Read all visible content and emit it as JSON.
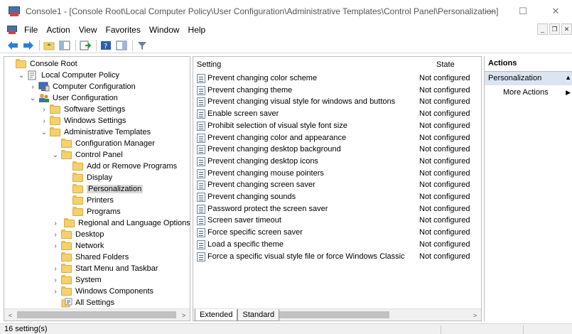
{
  "window": {
    "title": "Console1 - [Console Root\\Local Computer Policy\\User Configuration\\Administrative Templates\\Control Panel\\Personalization]",
    "minimize": "—",
    "maximize": "☐",
    "close": "✕"
  },
  "menu": {
    "items": [
      "File",
      "Action",
      "View",
      "Favorites",
      "Window",
      "Help"
    ],
    "mdi_minimize": "_",
    "mdi_restore": "❐",
    "mdi_close": "✕"
  },
  "tree": {
    "items": [
      {
        "label": "Console Root",
        "icon": "folder-icon"
      },
      {
        "label": "Local Computer Policy",
        "icon": "policy-icon"
      },
      {
        "label": "Computer Configuration",
        "icon": "computer-icon"
      },
      {
        "label": "User Configuration",
        "icon": "users-icon"
      },
      {
        "label": "Software Settings",
        "icon": "folder-icon"
      },
      {
        "label": "Windows Settings",
        "icon": "folder-icon"
      },
      {
        "label": "Administrative Templates",
        "icon": "folder-icon"
      },
      {
        "label": "Configuration Manager",
        "icon": "folder-icon"
      },
      {
        "label": "Control Panel",
        "icon": "folder-icon"
      },
      {
        "label": "Add or Remove Programs",
        "icon": "folder-icon"
      },
      {
        "label": "Display",
        "icon": "folder-icon"
      },
      {
        "label": "Personalization",
        "icon": "folder-icon"
      },
      {
        "label": "Printers",
        "icon": "folder-icon"
      },
      {
        "label": "Programs",
        "icon": "folder-icon"
      },
      {
        "label": "Regional and Language Options",
        "icon": "folder-icon"
      },
      {
        "label": "Desktop",
        "icon": "folder-icon"
      },
      {
        "label": "Network",
        "icon": "folder-icon"
      },
      {
        "label": "Shared Folders",
        "icon": "folder-icon"
      },
      {
        "label": "Start Menu and Taskbar",
        "icon": "folder-icon"
      },
      {
        "label": "System",
        "icon": "folder-icon"
      },
      {
        "label": "Windows Components",
        "icon": "folder-icon"
      },
      {
        "label": "All Settings",
        "icon": "all-settings-icon"
      }
    ]
  },
  "list": {
    "header_setting": "Setting",
    "header_state": "State",
    "rows": [
      {
        "name": "Prevent changing color scheme",
        "state": "Not configured"
      },
      {
        "name": "Prevent changing theme",
        "state": "Not configured"
      },
      {
        "name": "Prevent changing visual style for windows and buttons",
        "state": "Not configured"
      },
      {
        "name": "Enable screen saver",
        "state": "Not configured"
      },
      {
        "name": "Prohibit selection of visual style font size",
        "state": "Not configured"
      },
      {
        "name": "Prevent changing color and appearance",
        "state": "Not configured"
      },
      {
        "name": "Prevent changing desktop background",
        "state": "Not configured"
      },
      {
        "name": "Prevent changing desktop icons",
        "state": "Not configured"
      },
      {
        "name": "Prevent changing mouse pointers",
        "state": "Not configured"
      },
      {
        "name": "Prevent changing screen saver",
        "state": "Not configured"
      },
      {
        "name": "Prevent changing sounds",
        "state": "Not configured"
      },
      {
        "name": "Password protect the screen saver",
        "state": "Not configured"
      },
      {
        "name": "Screen saver timeout",
        "state": "Not configured"
      },
      {
        "name": "Force specific screen saver",
        "state": "Not configured"
      },
      {
        "name": "Load a specific theme",
        "state": "Not configured"
      },
      {
        "name": "Force a specific visual style file or force Windows Classic",
        "state": "Not configured"
      }
    ]
  },
  "tabs": [
    "Extended",
    "Standard"
  ],
  "actions": {
    "title": "Actions",
    "section": "Personalization",
    "more": "More Actions"
  },
  "status": "16 setting(s)",
  "colors": {
    "accent": "#dbe4f1",
    "selected": "#d9d9d9",
    "folder": "#f6d06e"
  }
}
